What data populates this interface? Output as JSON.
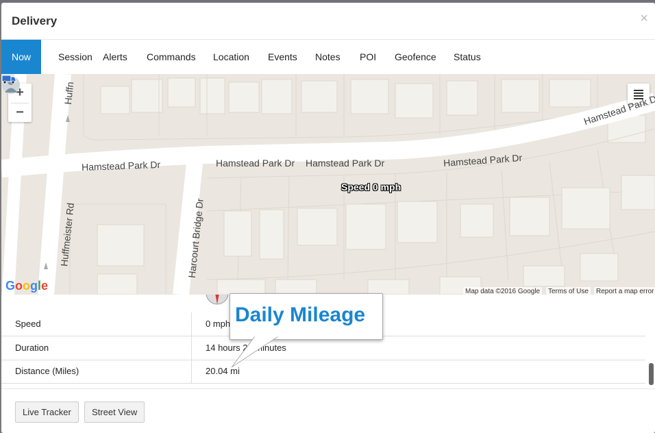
{
  "window": {
    "title": "Delivery",
    "close_label": "×"
  },
  "tabs": [
    {
      "label": "Now",
      "active": true
    },
    {
      "label": "Session"
    },
    {
      "label": "Alerts"
    },
    {
      "label": "Commands"
    },
    {
      "label": "Location"
    },
    {
      "label": "Events"
    },
    {
      "label": "Notes"
    },
    {
      "label": "POI"
    },
    {
      "label": "Geofence"
    },
    {
      "label": "Status"
    }
  ],
  "map": {
    "zoom_in": "+",
    "zoom_out": "−",
    "streets": {
      "hamstead_1": "Hamstead Park Dr",
      "hamstead_2": "Hamstead Park Dr",
      "hamstead_3": "Hamstead Park Dr",
      "hamstead_4": "Hamstead Park Dr",
      "hamstead_5": "Hamstead Park Dr",
      "huffmeister": "Huffmeister Rd",
      "huff_top": "Huffn",
      "harcourt": "Harcourt Bridge Dr"
    },
    "vehicle_label": "Speed 0 mph",
    "google_logo": "Google",
    "attribution": {
      "map_data": "Map data ©2016 Google",
      "terms": "Terms of Use",
      "report": "Report a map error"
    },
    "colors": {
      "land": "#ebe7e0",
      "road": "#ffffff",
      "building": "#f3f1ec"
    }
  },
  "details": [
    {
      "label": "Speed",
      "value": "0 mph"
    },
    {
      "label": "Duration",
      "value": "14 hours 22 minutes"
    },
    {
      "label": "Distance (Miles)",
      "value": "20.04 mi"
    }
  ],
  "callout": {
    "text": "Daily Mileage"
  },
  "footer": {
    "live_tracker": "Live Tracker",
    "street_view": "Street View"
  },
  "accent_color": "#1a86d0"
}
